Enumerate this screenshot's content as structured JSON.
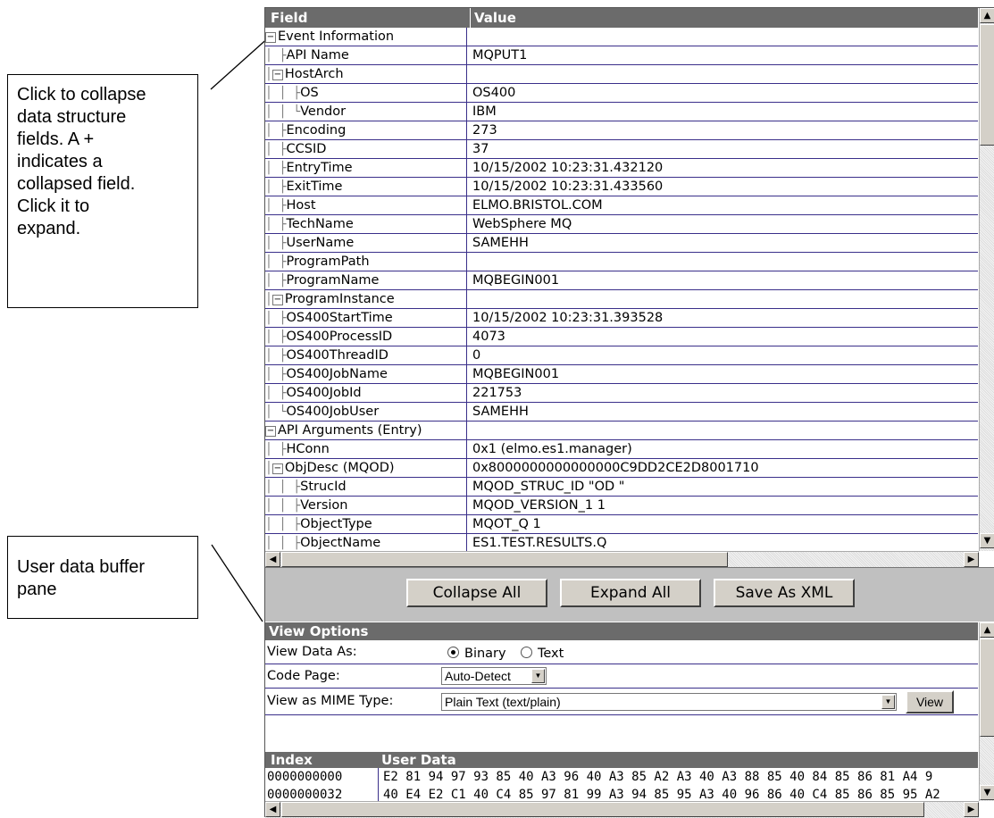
{
  "callouts": {
    "collapse_help": "Click to collapse\ndata structure\nfields. A +\nindicates a\ncollapsed field.\nClick it to\nexpand.",
    "user_data_help": "User data buffer\npane"
  },
  "tree_table": {
    "columns": {
      "field": "Field",
      "value": "Value"
    },
    "rows": [
      {
        "guides": "",
        "expander": "⊟",
        "field": "Event Information",
        "value": ""
      },
      {
        "guides": "│ ├",
        "expander": "",
        "field": "API Name",
        "value": "MQPUT1"
      },
      {
        "guides": "│",
        "expander": "⊟",
        "field": "HostArch",
        "value": ""
      },
      {
        "guides": "│ │ ├",
        "expander": "",
        "field": "OS",
        "value": "OS400"
      },
      {
        "guides": "│ │ └",
        "expander": "",
        "field": "Vendor",
        "value": "IBM"
      },
      {
        "guides": "│ ├",
        "expander": "",
        "field": "Encoding",
        "value": "273"
      },
      {
        "guides": "│ ├",
        "expander": "",
        "field": "CCSID",
        "value": "37"
      },
      {
        "guides": "│ ├",
        "expander": "",
        "field": "EntryTime",
        "value": "10/15/2002 10:23:31.432120"
      },
      {
        "guides": "│ ├",
        "expander": "",
        "field": "ExitTime",
        "value": "10/15/2002 10:23:31.433560"
      },
      {
        "guides": "│ ├",
        "expander": "",
        "field": "Host",
        "value": "ELMO.BRISTOL.COM"
      },
      {
        "guides": "│ ├",
        "expander": "",
        "field": "TechName",
        "value": "WebSphere MQ"
      },
      {
        "guides": "│ ├",
        "expander": "",
        "field": "UserName",
        "value": "SAMEHH"
      },
      {
        "guides": "│ ├",
        "expander": "",
        "field": "ProgramPath",
        "value": ""
      },
      {
        "guides": "│ ├",
        "expander": "",
        "field": "ProgramName",
        "value": "MQBEGIN001"
      },
      {
        "guides": "│",
        "expander": "⊟",
        "field": "ProgramInstance",
        "value": ""
      },
      {
        "guides": "│   ├",
        "expander": "",
        "field": "OS400StartTime",
        "value": "10/15/2002 10:23:31.393528"
      },
      {
        "guides": "│   ├",
        "expander": "",
        "field": "OS400ProcessID",
        "value": "4073"
      },
      {
        "guides": "│   ├",
        "expander": "",
        "field": "OS400ThreadID",
        "value": "0"
      },
      {
        "guides": "│   ├",
        "expander": "",
        "field": "OS400JobName",
        "value": "MQBEGIN001"
      },
      {
        "guides": "│   ├",
        "expander": "",
        "field": "OS400JobId",
        "value": "221753"
      },
      {
        "guides": "│   └",
        "expander": "",
        "field": "OS400JobUser",
        "value": "SAMEHH"
      },
      {
        "guides": "",
        "expander": "⊟",
        "field": "API Arguments (Entry)",
        "value": ""
      },
      {
        "guides": "│ ├",
        "expander": "",
        "field": "HConn",
        "value": "0x1 (elmo.es1.manager)"
      },
      {
        "guides": "│",
        "expander": "⊟",
        "field": "ObjDesc (MQOD)",
        "value": "0x8000000000000000C9DD2CE2D8001710"
      },
      {
        "guides": "│ │ ├",
        "expander": "",
        "field": "StrucId",
        "value": "MQOD_STRUC_ID \"OD  \""
      },
      {
        "guides": "│ │ ├",
        "expander": "",
        "field": "Version",
        "value": "MQOD_VERSION_1 1"
      },
      {
        "guides": "│ │ ├",
        "expander": "",
        "field": "ObjectType",
        "value": "MQOT_Q 1"
      },
      {
        "guides": "│ │ ├",
        "expander": "",
        "field": "ObjectName",
        "value": "ES1.TEST.RESULTS.Q"
      }
    ]
  },
  "buttons": {
    "collapse_all": "Collapse All",
    "expand_all": "Expand All",
    "save_as_xml": "Save As XML"
  },
  "view_options": {
    "header": "View Options",
    "view_data_as_label": "View Data As:",
    "binary_label": "Binary",
    "text_label": "Text",
    "selected_mode": "Binary",
    "code_page_label": "Code Page:",
    "code_page_value": "Auto-Detect",
    "mime_label": "View as MIME Type:",
    "mime_value": "Plain Text (text/plain)",
    "view_button": "View"
  },
  "user_data": {
    "columns": {
      "index": "Index",
      "data": "User Data"
    },
    "rows": [
      {
        "index": "0000000000",
        "data": "E2 81 94 97 93 85 40 A3 96 40 A3 85 A2 A3 40 A3 88 85 40 84 85 86 81 A4 9"
      },
      {
        "index": "0000000032",
        "data": "40 E4 E2 C1 40 C4 85 97 81 99 A3 94 85 95 A3 40 96 86 40 C4 85 86 85 95 A2"
      }
    ]
  }
}
